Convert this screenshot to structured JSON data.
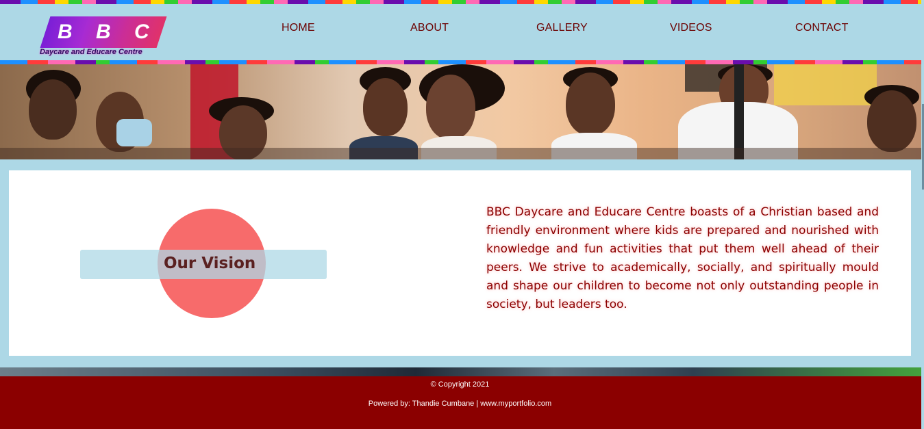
{
  "logo": {
    "letters": [
      "B",
      "B",
      "C"
    ],
    "tagline": "Daycare and Educare Centre"
  },
  "nav": {
    "home": "HOME",
    "about": "ABOUT",
    "gallery": "GALLERY",
    "videos": "VIDEOS",
    "contact": "CONTACT"
  },
  "vision": {
    "title": "Our Vision",
    "text": "BBC Daycare and Educare Centre boasts of a Christian based and friendly environment where kids are prepared and nourished with knowledge and fun activities that put them well ahead of their peers. We strive to academically, socially, and spiritually mould and shape our children to become not only outstanding people in society, but leaders too."
  },
  "footer": {
    "copyright": "© Copyright 2021",
    "powered": "Powered by: Thandie Cumbane | www.myportfolio.com"
  },
  "colors": {
    "page_background": "#add8e6",
    "nav_text": "#6b0000",
    "vision_circle": "#f76b6b",
    "vision_text": "#8b0000",
    "footer_background": "#8b0000"
  }
}
